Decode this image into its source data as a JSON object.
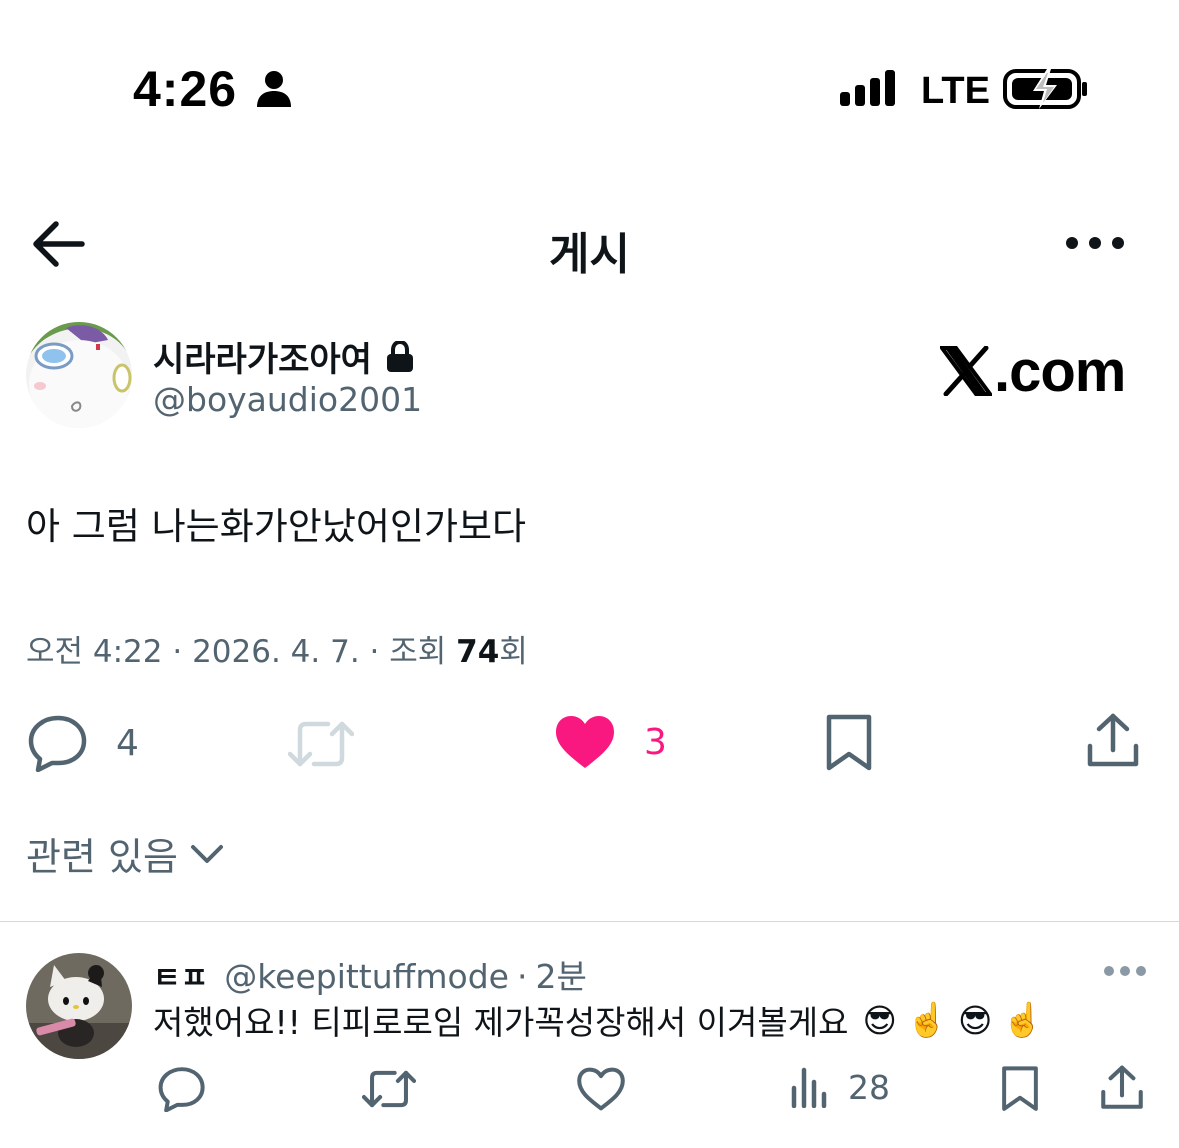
{
  "status_bar": {
    "time": "4:26",
    "network": "LTE"
  },
  "nav": {
    "title": "게시"
  },
  "post": {
    "author_name": "시라라가조아여",
    "author_handle": "@boyaudio2001",
    "watermark": "X.com",
    "text": "아 그럼 나는화가안났어인가보다",
    "timestamp": "오전 4:22 · 2026. 4. 7. · 조회 ",
    "views": "74",
    "views_suffix": "회",
    "replies": "4",
    "likes": "3",
    "liked": true
  },
  "related": {
    "label": "관련 있음"
  },
  "reply": {
    "name": "ㅌㅍ",
    "handle": "@keepittuffmode",
    "separator": "·",
    "time": "2분",
    "text": "저했어요!! 티피로로임 제가꼭성장해서 이겨볼게요",
    "emojis": [
      "😎",
      "☝️",
      "😎",
      "☝️"
    ],
    "views": "28"
  },
  "colors": {
    "text_primary": "#0f1419",
    "text_secondary": "#536471",
    "like_pink": "#f91880",
    "retweet_disabled": "#cfd9de",
    "divider": "#cfd9de"
  },
  "icons": [
    "person-icon",
    "signal-icon",
    "battery-charging-icon",
    "back-arrow-icon",
    "more-icon",
    "lock-icon",
    "reply-icon",
    "retweet-icon",
    "heart-icon",
    "bookmark-icon",
    "share-icon",
    "chevron-down-icon",
    "views-icon"
  ]
}
